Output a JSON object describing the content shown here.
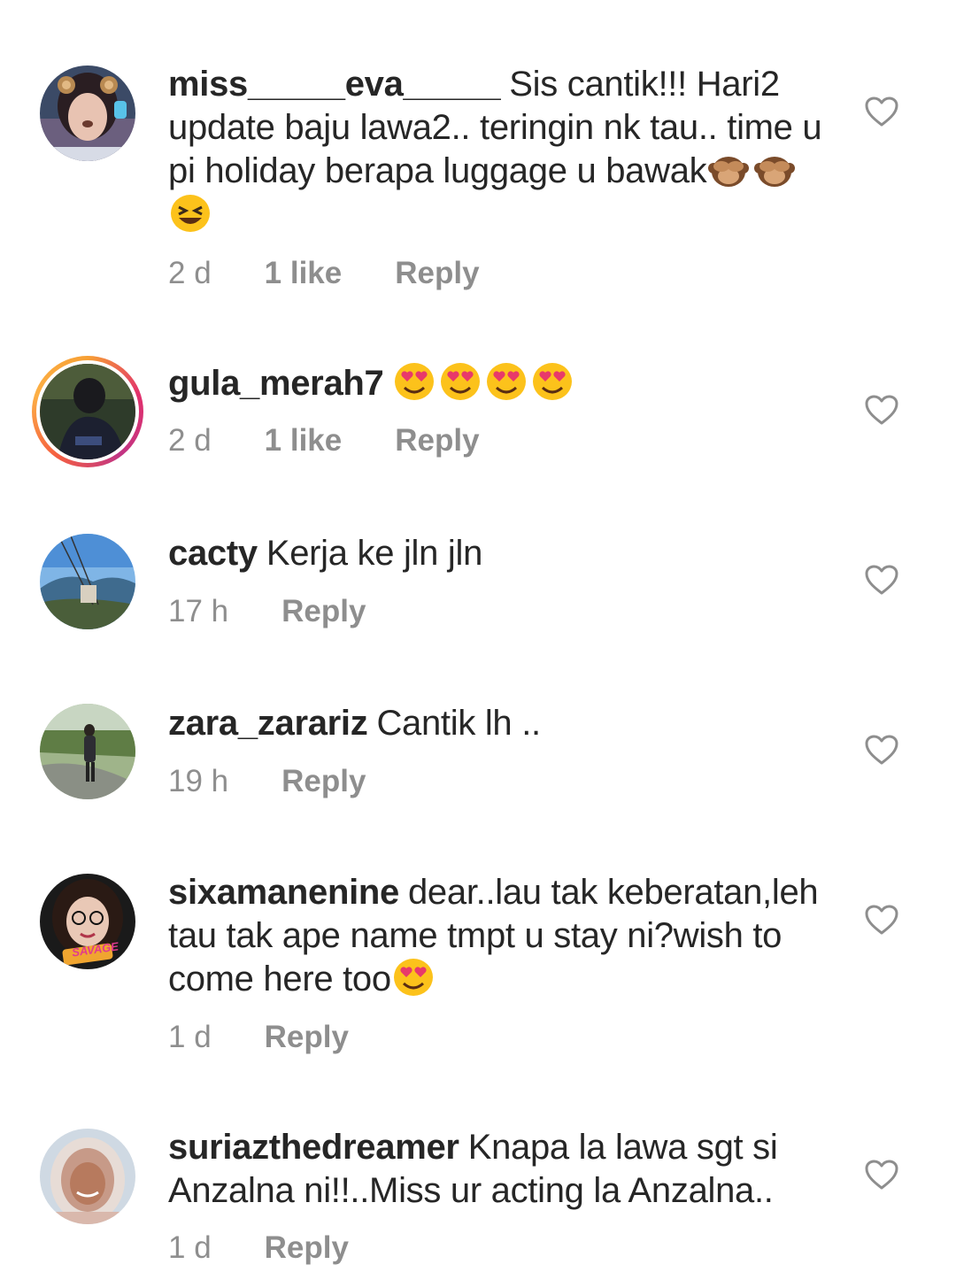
{
  "comments": [
    {
      "username": "miss_____eva_____",
      "text": "Sis cantik!!! Hari2 update baju lawa2.. teringin nk tau.. time u pi holiday berapa luggage u bawak",
      "emojis": [
        "see-no-evil-monkey",
        "see-no-evil-monkey",
        "grinning-squinting-face"
      ],
      "time": "2 d",
      "likes": "1 like",
      "reply": "Reply"
    },
    {
      "username": "gula_merah7",
      "text": "",
      "emojis": [
        "heart-eyes-face",
        "heart-eyes-face",
        "heart-eyes-face",
        "heart-eyes-face"
      ],
      "time": "2 d",
      "likes": "1 like",
      "reply": "Reply"
    },
    {
      "username": "cacty",
      "text": "Kerja ke jln jln",
      "time": "17 h",
      "reply": "Reply"
    },
    {
      "username": "zara_zarariz",
      "text": "Cantik lh ..",
      "time": "19 h",
      "reply": "Reply"
    },
    {
      "username": "sixamanenine",
      "text": "dear..lau tak keberatan,leh tau tak ape name tmpt u stay ni?wish to come here too",
      "emojis": [
        "heart-eyes-face"
      ],
      "time": "1 d",
      "reply": "Reply"
    },
    {
      "username": "suriazthedreamer",
      "text": "Knapa la lawa sgt si Anzalna ni!!..Miss ur acting la Anzalna..",
      "time": "1 d",
      "reply": "Reply"
    }
  ],
  "avatar_badge_text": "SAVAGE"
}
